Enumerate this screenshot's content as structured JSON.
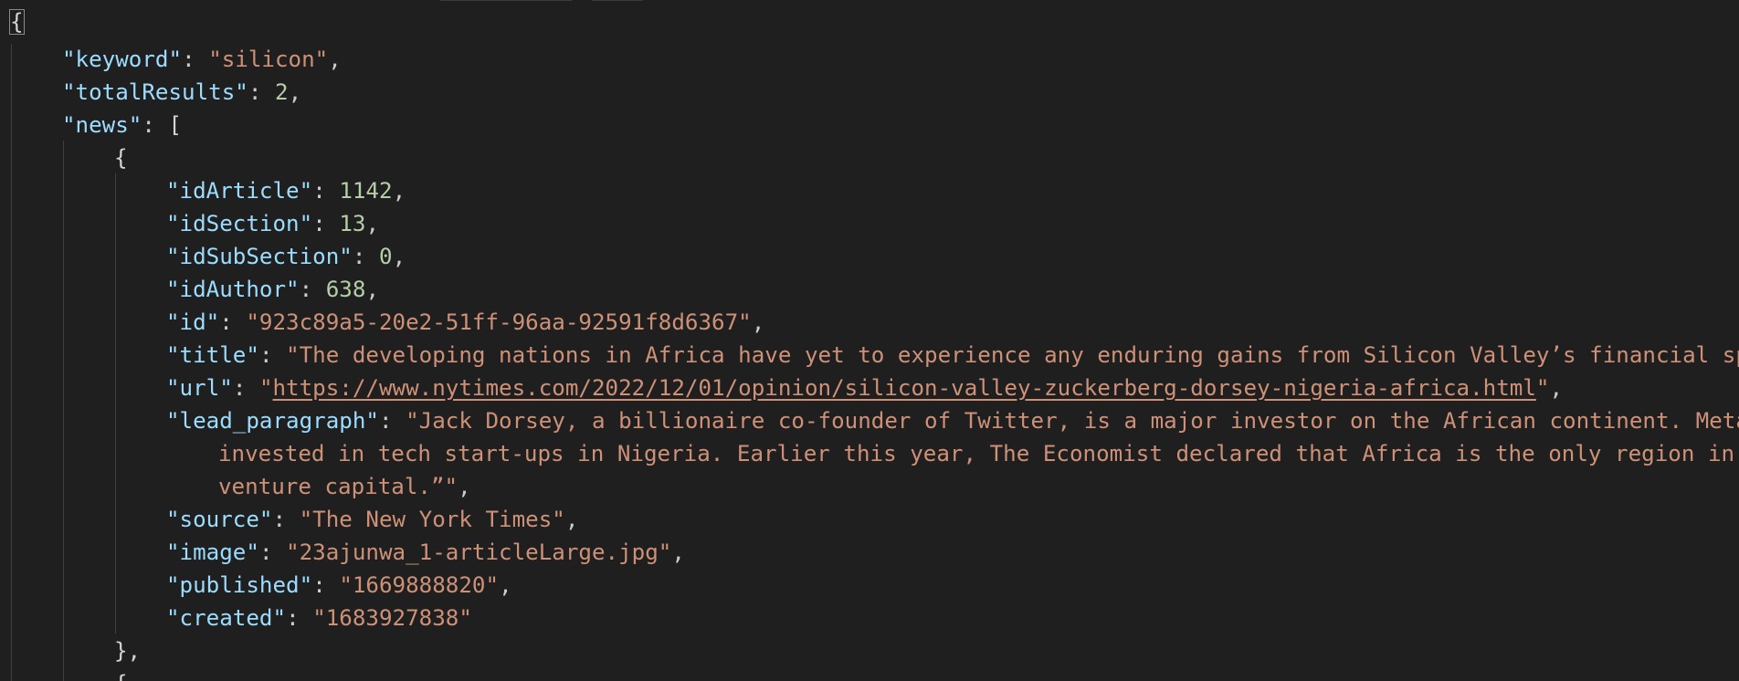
{
  "editor": {
    "brace_open": "{",
    "lines": [
      {
        "key": "\"keyword\"",
        "sep": ": ",
        "value": "\"silicon\"",
        "tail": ","
      },
      {
        "key": "\"totalResults\"",
        "sep": ": ",
        "value": "2",
        "tail": ","
      },
      {
        "key": "\"news\"",
        "sep": ": ",
        "value": "[",
        "tail": ""
      }
    ],
    "item_open": "{",
    "item": {
      "idArticle": {
        "key": "\"idArticle\"",
        "value": "1142"
      },
      "idSection": {
        "key": "\"idSection\"",
        "value": "13"
      },
      "idSubSection": {
        "key": "\"idSubSection\"",
        "value": "0"
      },
      "idAuthor": {
        "key": "\"idAuthor\"",
        "value": "638"
      },
      "id": {
        "key": "\"id\"",
        "value": "\"923c89a5-20e2-51ff-96aa-92591f8d6367\""
      },
      "title": {
        "key": "\"title\"",
        "value": "\"The developing nations in Africa have yet to experience any enduring gains from Silicon Valley’s financial spe"
      },
      "url": {
        "key": "\"url\"",
        "quote_open": "\"",
        "link": "https://www.nytimes.com/2022/12/01/opinion/silicon-valley-zuckerberg-dorsey-nigeria-africa.html",
        "quote_close": "\""
      },
      "lead_paragraph": {
        "key": "\"lead_paragraph\"",
        "line1": "\"Jack Dorsey, a billionaire co-founder of Twitter, is a major investor on the African continent. Meta’",
        "line2": "invested in tech start-ups in Nigeria. Earlier this year, The Economist declared that Africa is the only region in t",
        "line3": "venture capital.”\""
      },
      "source": {
        "key": "\"source\"",
        "value": "\"The New York Times\""
      },
      "image": {
        "key": "\"image\"",
        "value": "\"23ajunwa_1-articleLarge.jpg\""
      },
      "published": {
        "key": "\"published\"",
        "value": "\"1669888820\""
      },
      "created": {
        "key": "\"created\"",
        "value": "\"1683927838\""
      }
    },
    "item_close": "},",
    "next_item_open": "{",
    "sep": ": ",
    "comma": ","
  },
  "colors": {
    "background": "#1f1f1f",
    "key": "#9cdcfe",
    "string": "#ce9178",
    "number": "#b5cea8",
    "punctuation": "#cccccc"
  }
}
